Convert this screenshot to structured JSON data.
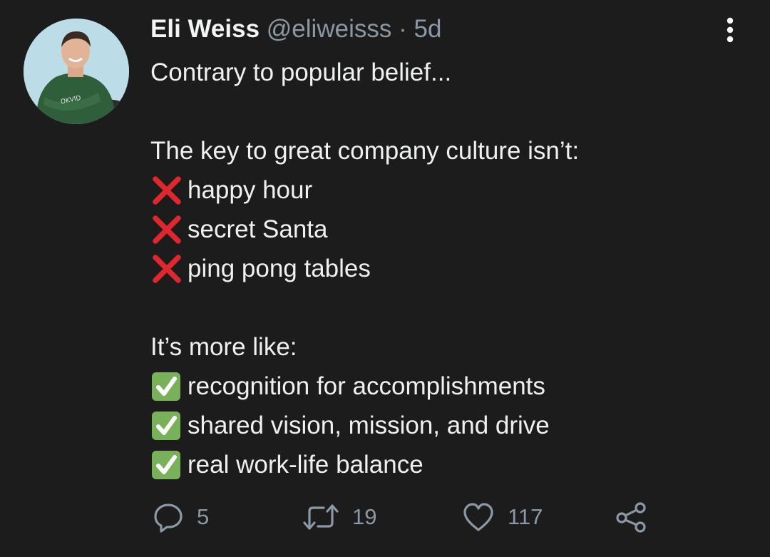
{
  "author": {
    "name": "Eli Weiss",
    "handle": "@eliweisss",
    "separator": "·",
    "timestamp": "5d",
    "avatar_icon": "profile-photo"
  },
  "tweet": {
    "intro": "Contrary to popular belief...",
    "not_heading": "The key to great company culture isn’t:",
    "not_items": [
      "happy hour",
      "secret Santa",
      "ping pong tables"
    ],
    "yes_heading": "It’s more like:",
    "yes_items": [
      "recognition for accomplishments",
      "shared vision, mission, and drive",
      "real work-life balance"
    ]
  },
  "actions": {
    "replies": "5",
    "retweets": "19",
    "likes": "117",
    "reply_icon": "reply-icon",
    "retweet_icon": "retweet-icon",
    "like_icon": "heart-icon",
    "share_icon": "share-icon",
    "more_icon": "more-vertical-icon"
  },
  "colors": {
    "background": "#1c1c1c",
    "text": "#e7e9ea",
    "muted": "#8b98a5",
    "cross": "#e0272d",
    "check": "#78b159"
  }
}
